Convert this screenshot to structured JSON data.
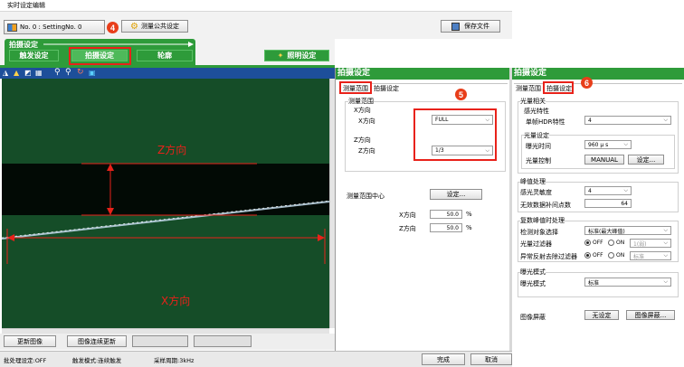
{
  "window_title": "实时设定编辑",
  "toolbar": {
    "setting_no": "No. 0 : SettingNo. 0",
    "measure_common_label": "测量公共设定",
    "save_label": "保存文件"
  },
  "tabs": {
    "group_label": "拍摄设定",
    "trigger": "触发设定",
    "capture": "拍摄设定",
    "profile": "轮廓",
    "lighting": "照明设定"
  },
  "viewer": {
    "z_label": "Z方向",
    "x_label": "X方向"
  },
  "bottom_buttons": {
    "update": "更新图像",
    "continuous": "图像连续更新"
  },
  "status": {
    "batch": "批处理设定:OFF",
    "trigger_mode": "触发模式:连续触发",
    "sampling": "采样周期:3kHz",
    "done": "完成",
    "cancel": "取消"
  },
  "badges": [
    "4",
    "5",
    "6"
  ],
  "panel_mid": {
    "title": "拍摄设定",
    "tab_range": "测量范围",
    "tab_capture": "拍摄设定",
    "range_group": "测量范围",
    "x_group": "X方向",
    "x_label": "X方向",
    "x_value": "FULL",
    "z_group": "Z方向",
    "z_label": "Z方向",
    "z_value": "1/3",
    "center_label": "测量范围中心",
    "set_btn": "设定...",
    "cx_label": "X方向",
    "cx_value": "50.0",
    "cz_label": "Z方向",
    "cz_value": "50.0",
    "unit": "%"
  },
  "panel_right": {
    "title": "拍摄设定",
    "tab_range": "测量范围",
    "tab_capture": "拍摄设定",
    "exposure_group": "光量相关",
    "sensitivity_group": "感光特性",
    "dynamic_range_label": "单帧HDR特性",
    "dynamic_range_value": "4",
    "light_group": "光量设定",
    "exposure_label": "曝光时间",
    "exposure_value": "960 μ s",
    "light_ctrl_label": "光量控制",
    "light_ctrl_value": "MANUAL",
    "light_ctrl_btn": "设定...",
    "threshold_group": "峰值处理",
    "min_sens_label": "感光灵敏度",
    "min_sens_value": "4",
    "invalid_label": "无效数据补间点数",
    "invalid_value": "64",
    "peak_group": "复数峰值时处理",
    "peak_select_label": "检测对象选择",
    "peak_select_value": "标准(最大峰值)",
    "light_filter_label": "光量过滤器",
    "light_filter_off": "OFF",
    "light_filter_on": "ON",
    "light_filter_value": "1(弱)",
    "reflect_label": "异常反射去除过滤器",
    "reflect_off": "OFF",
    "reflect_on": "ON",
    "reflect_value": "标准",
    "exp_mode_group": "曝光模式",
    "exp_mode_label": "曝光模式",
    "exp_mode_value": "标准",
    "mask_label": "图像屏蔽",
    "mask_value": "无设定",
    "mask_btn": "图像屏蔽..."
  }
}
